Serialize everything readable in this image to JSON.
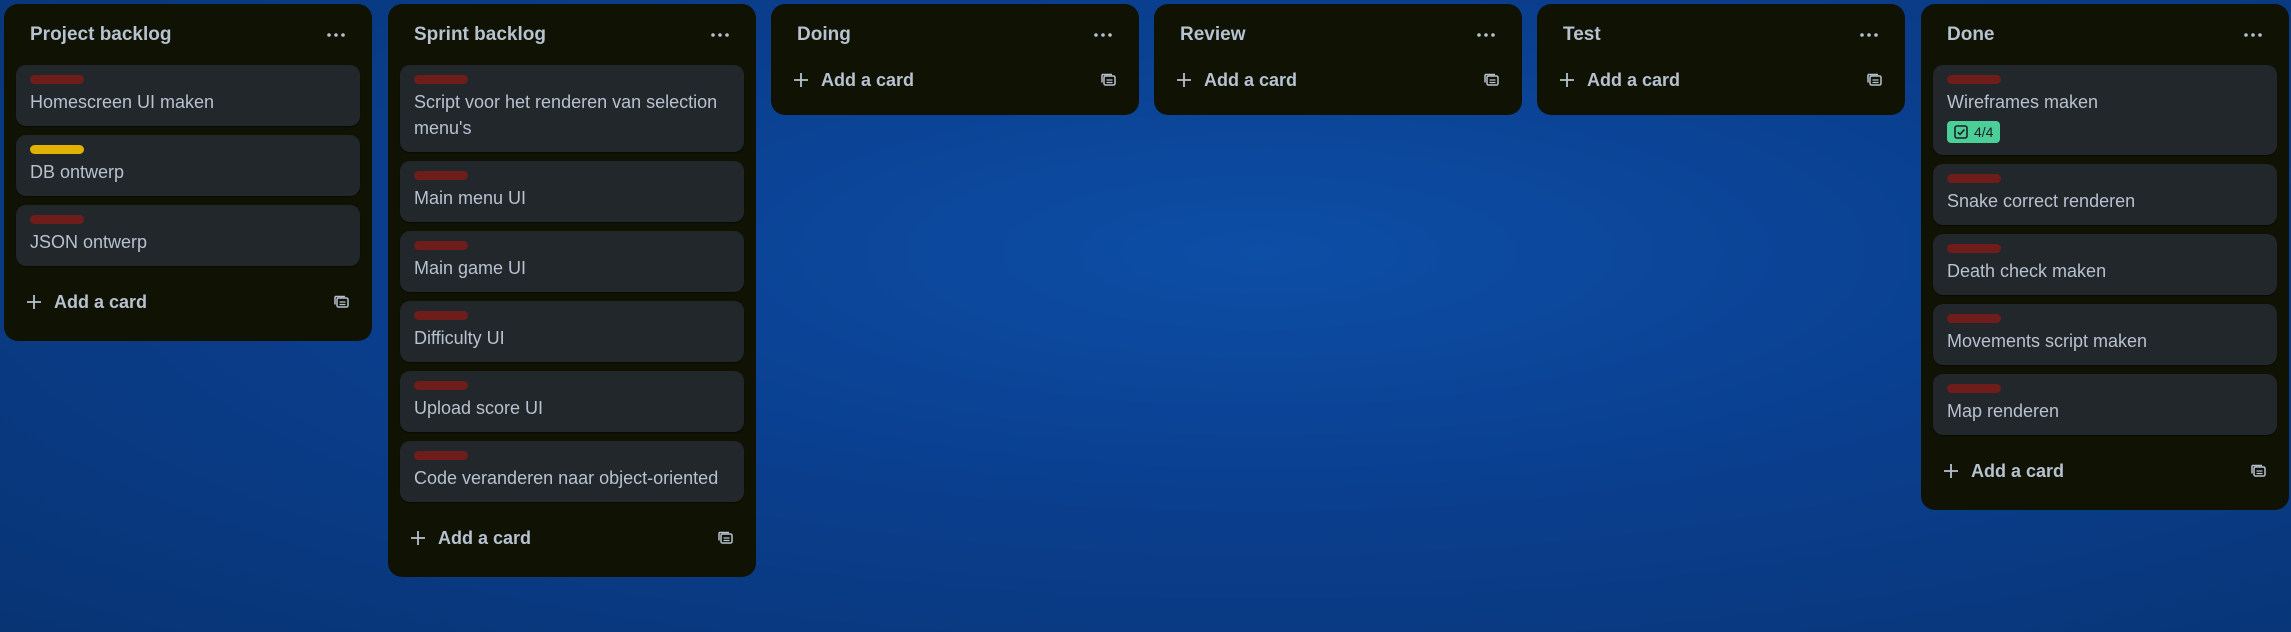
{
  "colors": {
    "label_red": "#6f1d1b",
    "label_yellow": "#e2b203",
    "badge_green": "#4bce97"
  },
  "icons": {
    "list_menu": "ellipsis-icon",
    "add": "plus-icon",
    "template": "card-template-icon",
    "checklist": "checkbox-icon"
  },
  "lists": [
    {
      "title": "Project backlog",
      "cards": [
        {
          "label_color": "red",
          "title": "Homescreen UI maken"
        },
        {
          "label_color": "yellow",
          "title": "DB ontwerp"
        },
        {
          "label_color": "red",
          "title": "JSON ontwerp"
        }
      ],
      "add_label": "Add a card"
    },
    {
      "title": "Sprint backlog",
      "cards": [
        {
          "label_color": "red",
          "title": "Script voor het renderen van selection menu's"
        },
        {
          "label_color": "red",
          "title": "Main menu UI"
        },
        {
          "label_color": "red",
          "title": "Main game UI"
        },
        {
          "label_color": "red",
          "title": "Difficulty UI"
        },
        {
          "label_color": "red",
          "title": "Upload score UI"
        },
        {
          "label_color": "red",
          "title": "Code veranderen naar object-oriented"
        }
      ],
      "add_label": "Add a card"
    },
    {
      "title": "Doing",
      "cards": [],
      "add_label": "Add a card"
    },
    {
      "title": "Review",
      "cards": [],
      "add_label": "Add a card"
    },
    {
      "title": "Test",
      "cards": [],
      "add_label": "Add a card"
    },
    {
      "title": "Done",
      "cards": [
        {
          "label_color": "red",
          "title": "Wireframes maken",
          "checklist": "4/4"
        },
        {
          "label_color": "red",
          "title": "Snake correct renderen"
        },
        {
          "label_color": "red",
          "title": "Death check maken"
        },
        {
          "label_color": "red",
          "title": "Movements script maken"
        },
        {
          "label_color": "red",
          "title": "Map renderen"
        }
      ],
      "add_label": "Add a card"
    }
  ]
}
